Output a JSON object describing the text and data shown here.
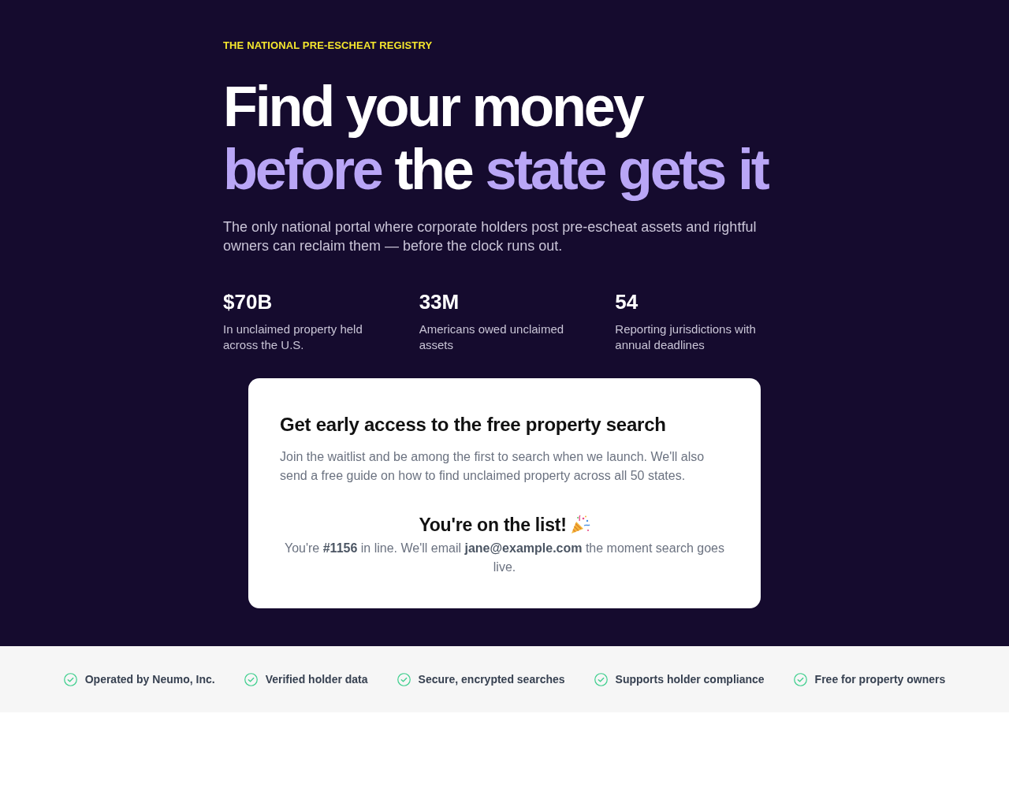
{
  "hero": {
    "eyebrow": "THE NATIONAL PRE-ESCHEAT REGISTRY",
    "headline": [
      [
        {
          "text": "Find your money",
          "highlight": false
        }
      ],
      [
        {
          "text": "before",
          "highlight": true
        },
        {
          "text": "the",
          "highlight": false
        },
        {
          "text": "state gets it",
          "highlight": true
        }
      ]
    ],
    "subtitle": "The only national portal where corporate holders post pre-escheat assets and rightful owners can reclaim them — before the clock runs out.",
    "stats": [
      {
        "value": "$70B",
        "label": "In unclaimed property held across the U.S."
      },
      {
        "value": "33M",
        "label": "Americans owed unclaimed assets"
      },
      {
        "value": "54",
        "label": "Reporting jurisdictions with annual deadlines"
      }
    ]
  },
  "signup_card": {
    "title": "Get early access to the free property search",
    "description": "Join the waitlist and be among the first to search when we launch. We'll also send a free guide on how to find unclaimed property across all 50 states.",
    "success_title": "You're on the list!",
    "success_message": "You're **#1156** in line. We'll email **jane@example.com** the moment search goes live."
  },
  "trust_bar": [
    "Operated by Neumo, Inc.",
    "Verified holder data",
    "Secure, encrypted searches",
    "Supports holder compliance",
    "Free for property owners"
  ]
}
